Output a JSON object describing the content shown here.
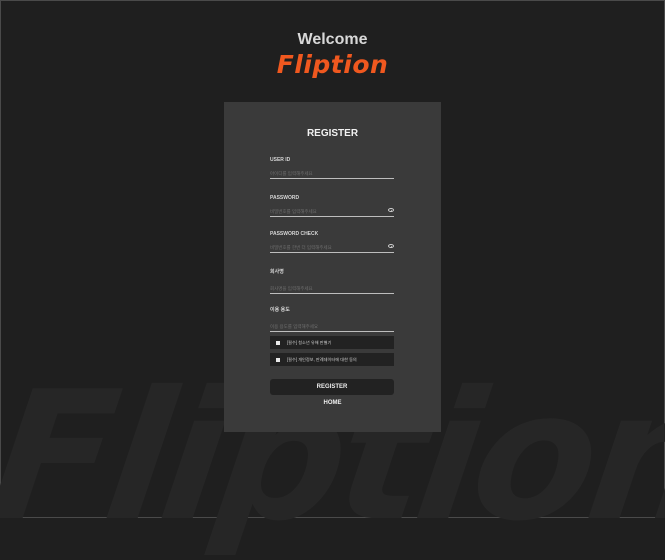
{
  "header": {
    "welcome": "Welcome",
    "logo": "Fliption"
  },
  "background": {
    "watermark": "Fliption"
  },
  "form": {
    "title": "REGISTER",
    "fields": [
      {
        "label": "USER ID",
        "placeholder": "아이디를 입력해주세요",
        "value": ""
      },
      {
        "label": "PASSWORD",
        "placeholder": "비밀번호를 입력해주세요",
        "value": ""
      },
      {
        "label": "PASSWORD CHECK",
        "placeholder": "비밀번호를 한번 더 입력해주세요",
        "value": ""
      },
      {
        "label": "회사명",
        "placeholder": "회사명을 입력해주세요",
        "value": ""
      },
      {
        "label": "이용 용도",
        "placeholder": "이용 용도를 입력해주세요",
        "value": ""
      }
    ],
    "agreements": [
      {
        "text": "[필수] 청소년 유해 판별기",
        "checked": false
      },
      {
        "text": "[필수] 개인정보, 판례데이터에 대한 동의",
        "checked": false
      }
    ],
    "register_label": "REGISTER",
    "home_label": "HOME"
  },
  "colors": {
    "accent": "#f0581f",
    "background": "#1f1f1f",
    "card": "#3a3a3a"
  },
  "icons": {
    "password_toggle": "eye-icon"
  }
}
